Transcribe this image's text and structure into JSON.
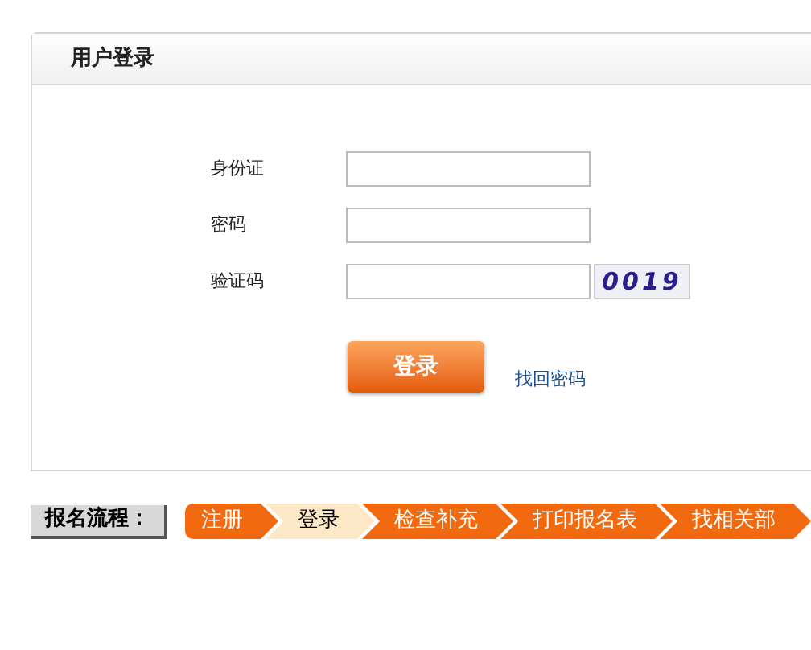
{
  "panel": {
    "title": "用户登录"
  },
  "fields": [
    {
      "label": "身份证"
    },
    {
      "label": "密码"
    },
    {
      "label": "验证码"
    }
  ],
  "captcha": "0019",
  "login_button": "登录",
  "recover_link": "找回密码",
  "process": {
    "label": "报名流程：",
    "steps": [
      {
        "label": "注册",
        "selected": false
      },
      {
        "label": "登录",
        "selected": true
      },
      {
        "label": "检查补充",
        "selected": false
      },
      {
        "label": "打印报名表",
        "selected": false
      },
      {
        "label": "找相关部",
        "selected": false
      }
    ]
  }
}
